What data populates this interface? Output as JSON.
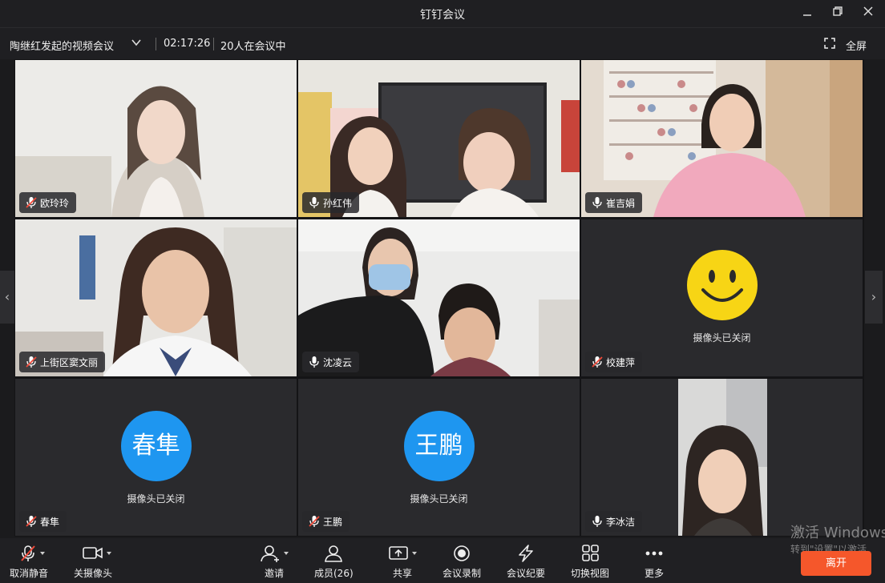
{
  "window": {
    "title": "钉钉会议"
  },
  "meeting": {
    "title": "陶继红发起的视频会议",
    "elapsed": "02:17:26",
    "participants_status": "20人在会议中",
    "fullscreen_label": "全屏"
  },
  "tiles": [
    {
      "name": "欧玲玲",
      "mic": "muted",
      "kind": "video"
    },
    {
      "name": "孙红伟",
      "mic": "on",
      "kind": "video"
    },
    {
      "name": "崔吉娟",
      "mic": "on",
      "kind": "video"
    },
    {
      "name": "上街区窦文丽",
      "mic": "muted",
      "kind": "video"
    },
    {
      "name": "沈凌云",
      "mic": "on",
      "kind": "video"
    },
    {
      "name": "校建萍",
      "mic": "muted",
      "kind": "camera-off-smiley",
      "camera_off_text": "摄像头已关闭"
    },
    {
      "name": "春隼",
      "mic": "muted",
      "kind": "camera-off-avatar",
      "avatar_text": "春隼",
      "camera_off_text": "摄像头已关闭"
    },
    {
      "name": "王鹏",
      "mic": "muted",
      "kind": "camera-off-avatar",
      "avatar_text": "王鹏",
      "camera_off_text": "摄像头已关闭"
    },
    {
      "name": "李冰洁",
      "mic": "on",
      "kind": "video"
    }
  ],
  "toolbar": {
    "unmute": "取消静音",
    "camera": "关摄像头",
    "invite": "邀请",
    "members": "成员(26)",
    "share": "共享",
    "record": "会议录制",
    "minutes": "会议纪要",
    "view": "切换视图",
    "more": "更多",
    "leave": "离开"
  },
  "watermark": {
    "line1": "激活 Windows",
    "line2": "转到\"设置\"以激活"
  },
  "colors": {
    "accent_blue": "#1e96f0",
    "leave_orange": "#f5572b",
    "background": "#1b1b1d"
  }
}
